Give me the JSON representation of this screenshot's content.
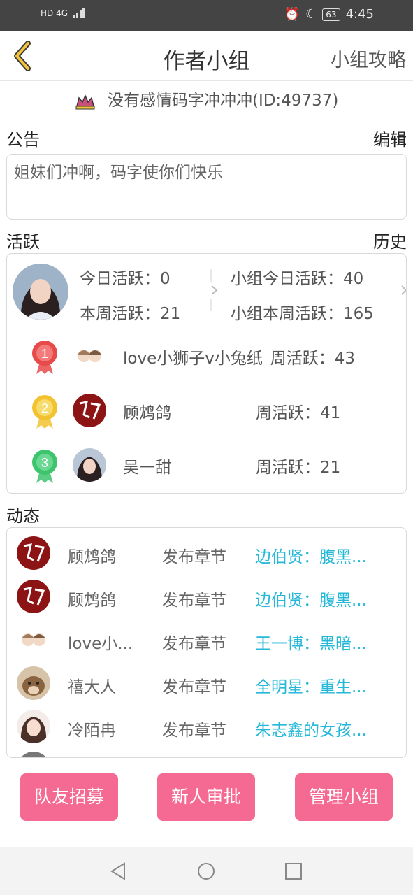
{
  "status_bar": {
    "left": "HD 4G",
    "battery": "63",
    "time": "4:45"
  },
  "header": {
    "title": "作者小组",
    "right_link": "小组攻略"
  },
  "group": {
    "name_line": "没有感情码字冲冲冲(ID:49737)"
  },
  "notice": {
    "section_label": "公告",
    "edit_label": "编辑",
    "text": "姐妹们冲啊，码字使你们快乐"
  },
  "activity": {
    "section_label": "活跃",
    "history_label": "历史",
    "my_today": "今日活跃：0",
    "my_week": "本周活跃：21",
    "group_today": "小组今日活跃：40",
    "group_week": "小组本周活跃：165",
    "ranking": [
      {
        "rank": "1",
        "name": "love小狮子v小兔纸",
        "week": "周活跃：43"
      },
      {
        "rank": "2",
        "name": "顾鸩鸽",
        "week": "周活跃：41"
      },
      {
        "rank": "3",
        "name": "吴一甜",
        "week": "周活跃：21"
      }
    ]
  },
  "feed": {
    "section_label": "动态",
    "items": [
      {
        "name": "顾鸩鸽",
        "action": "发布章节",
        "chapter": "边伯贤：腹黑..."
      },
      {
        "name": "顾鸩鸽",
        "action": "发布章节",
        "chapter": "边伯贤：腹黑..."
      },
      {
        "name": "love小...",
        "action": "发布章节",
        "chapter": "王一博：黑暗..."
      },
      {
        "name": "禧大人",
        "action": "发布章节",
        "chapter": "全明星：重生..."
      },
      {
        "name": "冷陌冉",
        "action": "发布章节",
        "chapter": "朱志鑫的女孩..."
      }
    ]
  },
  "buttons": {
    "recruit": "队友招募",
    "approve": "新人审批",
    "manage": "管理小组"
  },
  "colors": {
    "accent_pink": "#f56a93",
    "link_blue": "#25b8d8",
    "back_arrow": "#f3c43a",
    "medal_gold": "#f2c230",
    "medal_red": "#e84a4a",
    "medal_green": "#3ec46d"
  }
}
